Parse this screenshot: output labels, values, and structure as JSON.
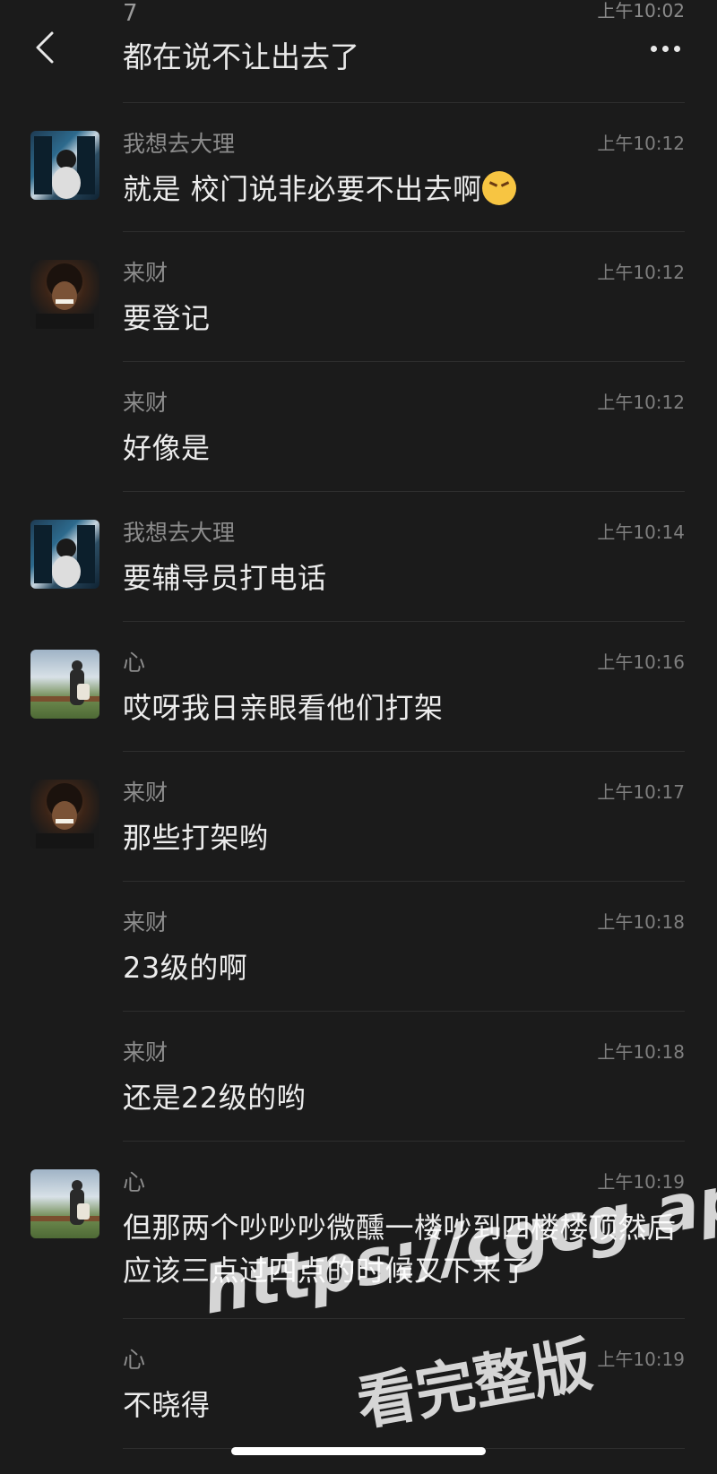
{
  "header": {
    "partial_sender": "7",
    "partial_time": "上午10:02",
    "first_message": "都在说不让出去了"
  },
  "messages": [
    {
      "sender": "我想去大理",
      "time": "上午10:12",
      "text": "就是 校门说非必要不出去啊",
      "avatar": "avatar-window-girl",
      "emoji": "tired-face-emoji"
    },
    {
      "sender": "来财",
      "time": "上午10:12",
      "text": "要登记",
      "avatar": "avatar-curly-man"
    },
    {
      "sender": "来财",
      "time": "上午10:12",
      "text": "好像是",
      "avatar": ""
    },
    {
      "sender": "我想去大理",
      "time": "上午10:14",
      "text": "要辅导员打电话",
      "avatar": "avatar-window-girl"
    },
    {
      "sender": "心",
      "time": "上午10:16",
      "text": "哎呀我日亲眼看他们打架",
      "avatar": "avatar-hiker"
    },
    {
      "sender": "来财",
      "time": "上午10:17",
      "text": "那些打架哟",
      "avatar": "avatar-curly-man"
    },
    {
      "sender": "来财",
      "time": "上午10:18",
      "text": "23级的啊",
      "avatar": ""
    },
    {
      "sender": "来财",
      "time": "上午10:18",
      "text": "还是22级的哟",
      "avatar": ""
    },
    {
      "sender": "心",
      "time": "上午10:19",
      "text": "但那两个吵吵吵微醺一楼吵到四楼楼顶然后应该三点过四点的时候又下来了",
      "avatar": "avatar-hiker"
    },
    {
      "sender": "心",
      "time": "上午10:19",
      "text": "不晓得",
      "avatar": ""
    }
  ],
  "watermark": {
    "line1": "https://cgcg.app",
    "line2": "看完整版"
  },
  "colors": {
    "background": "#1b1b1b",
    "text": "#ececec",
    "meta": "#8c8c8c",
    "divider": "#2e2e2e"
  }
}
